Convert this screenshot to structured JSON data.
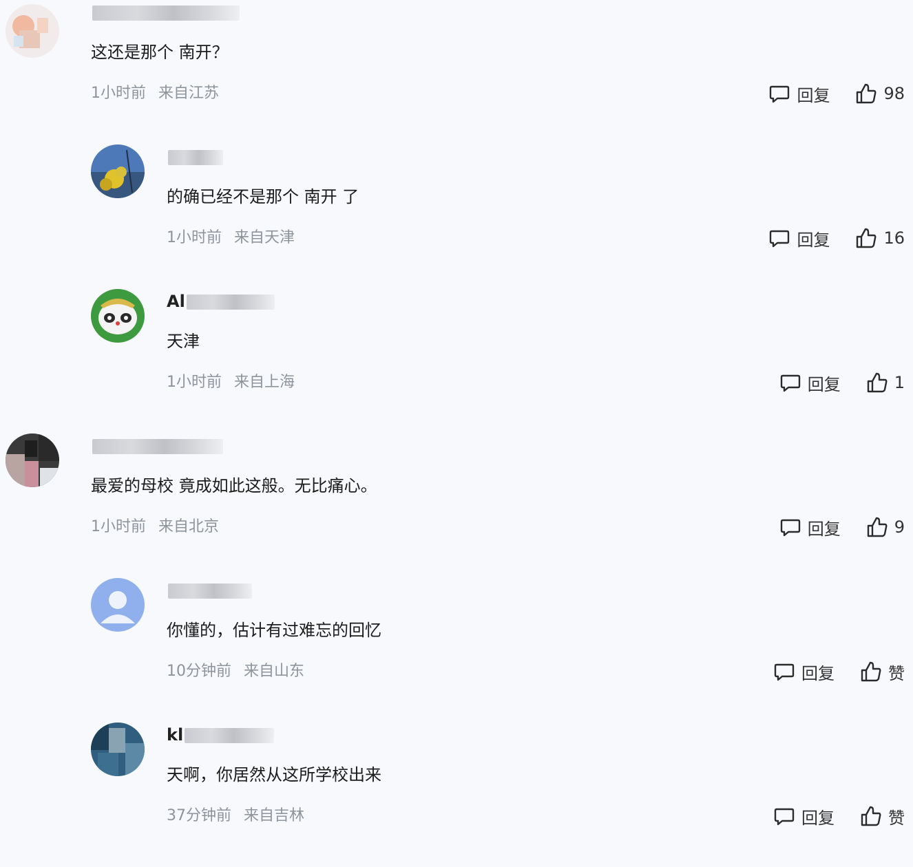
{
  "comments": [
    {
      "level": 0,
      "name_prefix": "",
      "text": "这还是那个 南开？",
      "time": "1小时前",
      "location": "来自江苏",
      "reply": "回复",
      "likes": "98"
    },
    {
      "level": 1,
      "name_prefix": "",
      "text": "的确已经不是那个 南开 了",
      "time": "1小时前",
      "location": "来自天津",
      "reply": "回复",
      "likes": "16"
    },
    {
      "level": 1,
      "name_prefix": "Al",
      "text": "天津",
      "time": "1小时前",
      "location": "来自上海",
      "reply": "回复",
      "likes": "1"
    },
    {
      "level": 0,
      "name_prefix": "",
      "text": "最爱的母校 竟成如此这般。无比痛心。",
      "time": "1小时前",
      "location": "来自北京",
      "reply": "回复",
      "likes": "9"
    },
    {
      "level": 1,
      "name_prefix": "",
      "text": "你懂的，估计有过难忘的回忆",
      "time": "10分钟前",
      "location": "来自山东",
      "reply": "回复",
      "likes": "赞"
    },
    {
      "level": 1,
      "name_prefix": "kl",
      "text": "天啊，你居然从这所学校出来",
      "time": "37分钟前",
      "location": "来自吉林",
      "reply": "回复",
      "likes": "赞"
    }
  ]
}
